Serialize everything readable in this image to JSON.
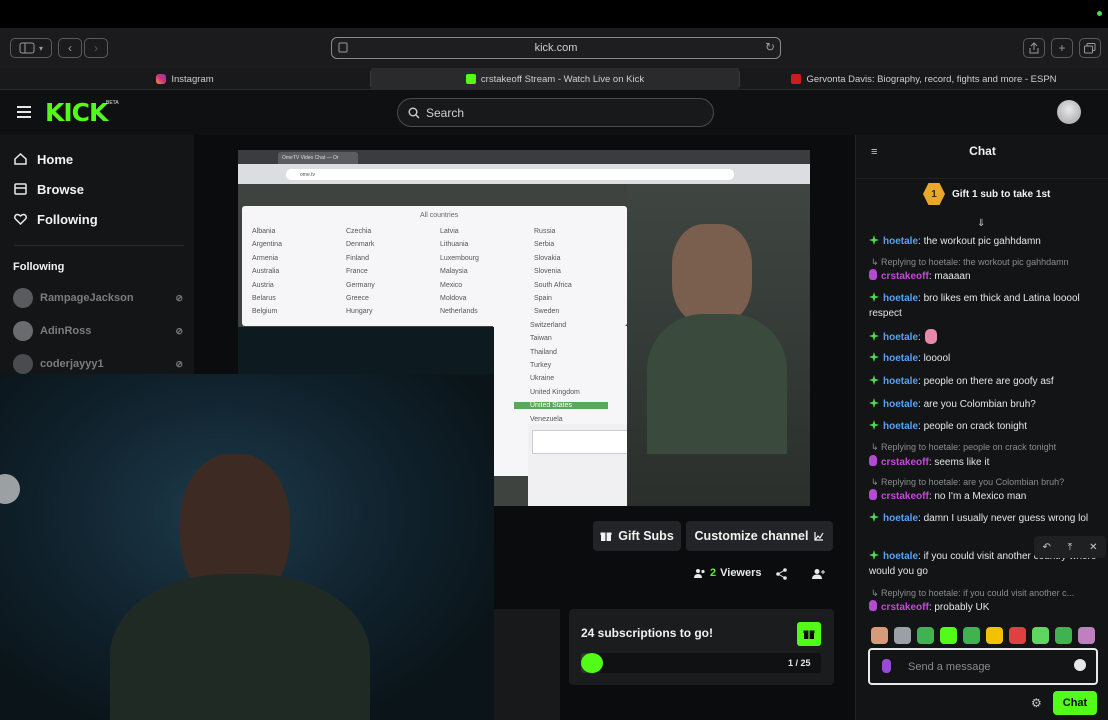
{
  "browser": {
    "url": "kick.com",
    "tabs": [
      {
        "title": "Instagram"
      },
      {
        "title": "crstakeoff Stream - Watch Live on Kick"
      },
      {
        "title": "Gervonta Davis: Biography, record, fights and more - ESPN"
      }
    ]
  },
  "kick": {
    "logo": "KICK",
    "logo_badge": "BETA",
    "search_placeholder": "Search"
  },
  "sidebar": {
    "nav": [
      {
        "label": "Home",
        "icon": "home-icon"
      },
      {
        "label": "Browse",
        "icon": "browse-icon"
      },
      {
        "label": "Following",
        "icon": "heart-icon"
      }
    ],
    "following_title": "Following",
    "following": [
      {
        "name": "RampageJackson"
      },
      {
        "name": "AdinRoss"
      },
      {
        "name": "coderjayyy1"
      }
    ]
  },
  "video": {
    "omegle_tab": "OmeTV Video Chat — Or",
    "omegle_url": "ome.tv",
    "all_countries": "All countries",
    "countries": [
      [
        "Albania",
        "Argentina",
        "Armenia",
        "Australia",
        "Austria",
        "Belarus",
        "Belgium"
      ],
      [
        "Czechia",
        "Denmark",
        "Finland",
        "France",
        "Germany",
        "Greece",
        "Hungary"
      ],
      [
        "Latvia",
        "Lithuania",
        "Luxembourg",
        "Malaysia",
        "Mexico",
        "Moldova",
        "Netherlands"
      ],
      [
        "Russia",
        "Serbia",
        "Slovakia",
        "Slovenia",
        "South Africa",
        "Spain",
        "Sweden",
        "Switzerland",
        "Taiwan",
        "Thailand",
        "Turkey",
        "Ukraine",
        "United Kingdom",
        "United States",
        "Venezuela"
      ]
    ],
    "selected_country": "United States"
  },
  "actions": {
    "gift_subs": "Gift Subs",
    "customize": "Customize channel",
    "viewers_count": "2",
    "viewers_label": "Viewers"
  },
  "subs_goal": {
    "title": "24 subscriptions to go!",
    "progress_text": "1 / 25",
    "progress_fraction": 0.04
  },
  "chat": {
    "title": "Chat",
    "gift_banner": "Gift 1 sub to take 1st",
    "gift_rank": "1",
    "messages": [
      {
        "type": "msg",
        "user": "hoetale",
        "text": ": the workout pic gahhdamn"
      },
      {
        "type": "reply",
        "text": "Replying to hoetale: the workout pic gahhdamn"
      },
      {
        "type": "msg",
        "user": "crstakeoff",
        "text": ": maaaan"
      },
      {
        "type": "msg",
        "user": "hoetale",
        "text": ": bro likes em thick and Latina looool respect"
      },
      {
        "type": "msg",
        "user": "hoetale",
        "text": ":"
      },
      {
        "type": "msg",
        "user": "hoetale",
        "text": ": looool"
      },
      {
        "type": "msg",
        "user": "hoetale",
        "text": ": people on there are goofy asf"
      },
      {
        "type": "msg",
        "user": "hoetale",
        "text": ": are you Colombian bruh?"
      },
      {
        "type": "msg",
        "user": "hoetale",
        "text": ": people on crack tonight"
      },
      {
        "type": "reply",
        "text": "Replying to hoetale: people on crack tonight"
      },
      {
        "type": "msg",
        "user": "crstakeoff",
        "text": ": seems like it"
      },
      {
        "type": "reply",
        "text": "Replying to hoetale: are you Colombian bruh?"
      },
      {
        "type": "msg",
        "user": "crstakeoff",
        "text": ": no I'm a Mexico man"
      },
      {
        "type": "msg",
        "user": "hoetale",
        "text": ": damn I usually never guess wrong lol"
      },
      {
        "type": "msg",
        "user": "hoetale",
        "text": ": if you could visit another country where would you go"
      },
      {
        "type": "reply",
        "text": "Replying to hoetale: if you could visit another c..."
      },
      {
        "type": "msg",
        "user": "crstakeoff",
        "text": ": probably UK"
      }
    ],
    "input_placeholder": "Send a message",
    "send_label": "Chat"
  },
  "colors": {
    "kick_green": "#53fc18",
    "hoetale": "#56a2f0",
    "crstakeoff": "#c24bd6"
  }
}
